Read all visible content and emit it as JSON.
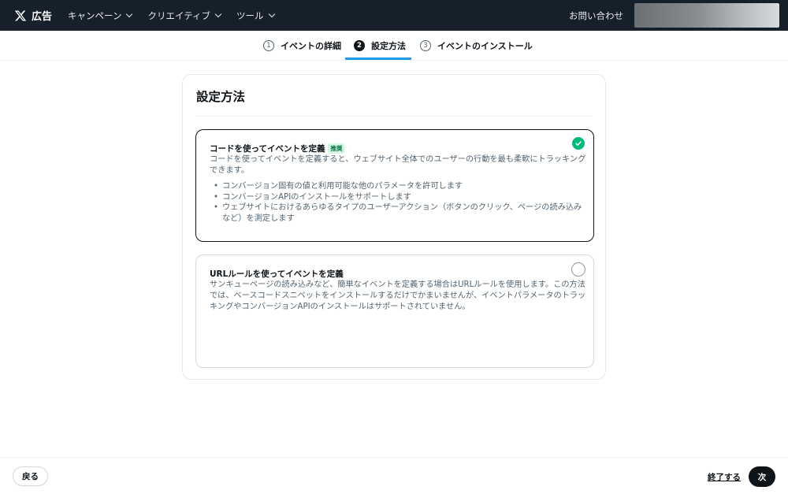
{
  "topnav": {
    "brand_text": "広告",
    "items": [
      {
        "label": "キャンペーン",
        "icon": "chevron-down-icon"
      },
      {
        "label": "クリエイティブ",
        "icon": "chevron-down-icon"
      },
      {
        "label": "ツール",
        "icon": "chevron-down-icon"
      }
    ],
    "contact_label": "お問い合わせ",
    "bg_color": "#15202b"
  },
  "stepper": {
    "steps": [
      {
        "num": "1",
        "label": "イベントの詳細"
      },
      {
        "num": "2",
        "label": "設定方法"
      },
      {
        "num": "3",
        "label": "イベントのインストール"
      }
    ],
    "active_step": 2,
    "accent_color": "#1d9bf0"
  },
  "card": {
    "title": "設定方法",
    "options": [
      {
        "title": "コードを使ってイベントを定義",
        "badge": "推奨",
        "description": "コードを使ってイベントを定義すると、ウェブサイト全体でのユーザーの行動を最も柔軟にトラッキングできます。",
        "bullets": [
          "コンバージョン固有の値と利用可能な他のパラメータを許可します",
          "コンバージョンAPIのインストールをサポートします",
          "ウェブサイトにおけるあらゆるタイプのユーザーアクション（ボタンのクリック、ページの読み込みなど）を測定します"
        ],
        "selected": true
      },
      {
        "title": "URLルールを使ってイベントを定義",
        "description": "サンキューページの読み込みなど、簡単なイベントを定義する場合はURLルールを使用します。この方法では、ベースコードスニペットをインストールするだけでかまいませんが、イベントパラメータのトラッキングやコンバージョンAPIのインストールはサポートされていません。",
        "selected": false
      }
    ],
    "check_color": "#00ba7c"
  },
  "footer": {
    "back_label": "戻る",
    "finish_label": "終了する",
    "next_label": "次"
  }
}
